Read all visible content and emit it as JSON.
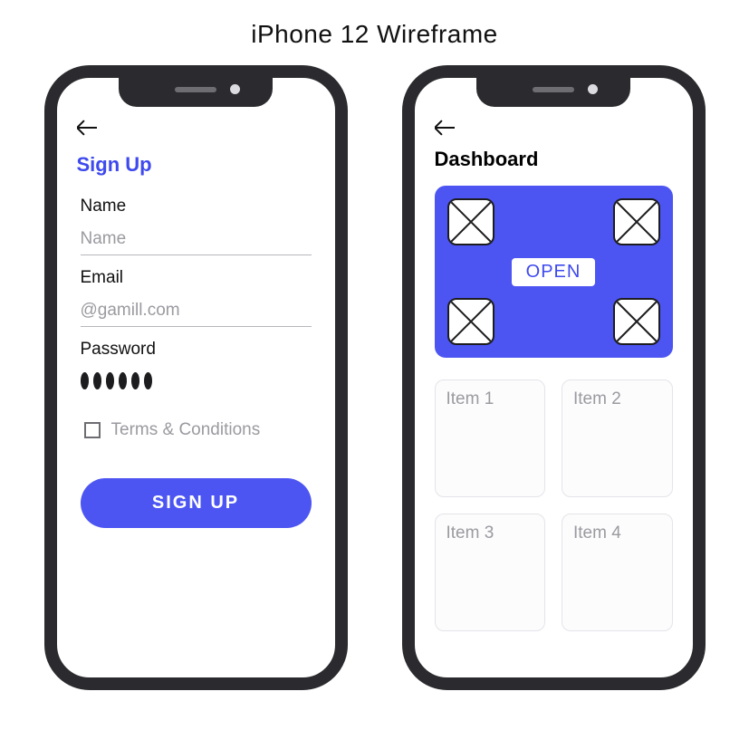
{
  "title": "iPhone 12 Wireframe",
  "signup": {
    "heading": "Sign Up",
    "name_label": "Name",
    "name_placeholder": "Name",
    "email_label": "Email",
    "email_placeholder": "@gamill.com",
    "password_label": "Password",
    "terms_label": "Terms & Conditions",
    "button_label": "SIGN  UP"
  },
  "dashboard": {
    "heading": "Dashboard",
    "open_label": "OPEN",
    "items": [
      "Item 1",
      "Item 2",
      "Item 3",
      "Item 4"
    ]
  }
}
